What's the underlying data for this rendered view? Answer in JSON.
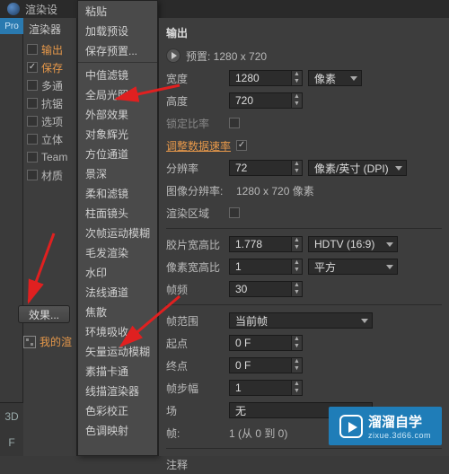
{
  "app": {
    "title": "渲染设"
  },
  "pro": "Pro",
  "panel1": {
    "header": "渲染器",
    "items": [
      {
        "label": "输出",
        "orange": true,
        "checked": false
      },
      {
        "label": "保存",
        "orange": true,
        "checked": true
      },
      {
        "label": "多通",
        "orange": false,
        "checked": false
      },
      {
        "label": "抗锯",
        "orange": false,
        "checked": false
      },
      {
        "label": "选项",
        "orange": false,
        "checked": false
      },
      {
        "label": "立体",
        "orange": false,
        "checked": false
      },
      {
        "label": "Team",
        "orange": false,
        "checked": false
      },
      {
        "label": "材质",
        "orange": false,
        "checked": false
      }
    ]
  },
  "effect_btn": "效果...",
  "my_render": "我的渲",
  "context_menu": {
    "top": [
      "粘贴",
      "加载预设",
      "保存预置..."
    ],
    "items": [
      "中值滤镜",
      "全局光照",
      "外部效果",
      "对象辉光",
      "方位通道",
      "景深",
      "柔和滤镜",
      "柱面镜头",
      "次帧运动模糊",
      "毛发渲染",
      "水印",
      "法线通道",
      "焦散",
      "环境吸收",
      "矢量运动模糊",
      "素描卡通",
      "线描渲染器",
      "色彩校正",
      "色调映射"
    ]
  },
  "output": {
    "title": "输出",
    "preset_label": "预置: 1280 x 720",
    "width_label": "宽度",
    "width_val": "1280",
    "unit_px": "像素",
    "height_label": "高度",
    "height_val": "720",
    "lock_label": "锁定比率",
    "adjust_label": "调整数据速率",
    "res_label": "分辨率",
    "res_val": "72",
    "res_unit": "像素/英寸 (DPI)",
    "img_res_label": "图像分辨率:",
    "img_res_val": "1280 x 720 像素",
    "region_label": "渲染区域",
    "film_label": "胶片宽高比",
    "film_val": "1.778",
    "film_sel": "HDTV (16:9)",
    "pixel_label": "像素宽高比",
    "pixel_val": "1",
    "pixel_sel": "平方",
    "fps_label": "帧频",
    "fps_val": "30",
    "range_label": "帧范围",
    "range_sel": "当前帧",
    "start_label": "起点",
    "start_val": "0 F",
    "end_label": "终点",
    "end_val": "0 F",
    "step_label": "帧步幅",
    "step_val": "1",
    "field_label": "场",
    "field_sel": "无",
    "frames_label": "帧:",
    "frames_val": "1 (从 0 到 0)",
    "notes_label": "注释"
  },
  "watermark": {
    "brand": "溜溜自学",
    "url": "zixue.3d66.com"
  },
  "bottom": {
    "a": "3D",
    "b": "F"
  }
}
